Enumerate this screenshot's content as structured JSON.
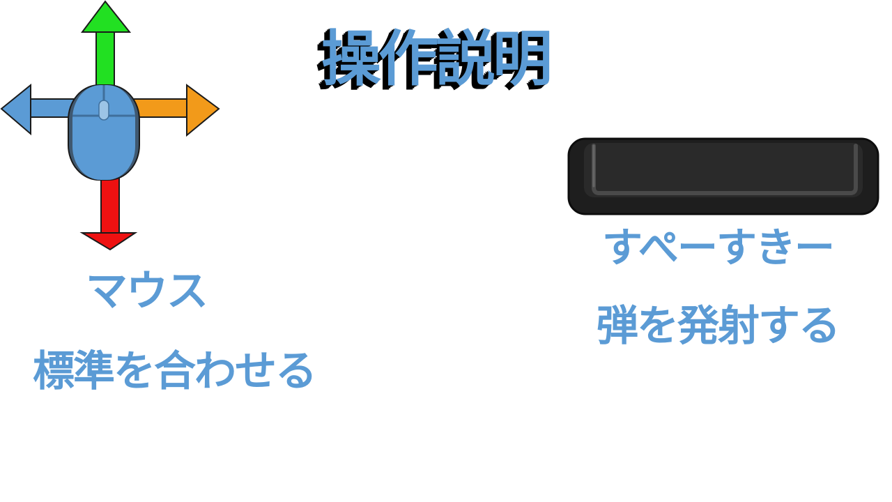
{
  "title": "操作説明",
  "mouse": {
    "name": "マウス",
    "description": "標準を合わせる",
    "icon": "mouse-with-direction-arrows-icon",
    "arrow_colors": {
      "up": "#22e022",
      "down": "#ee1111",
      "left": "#5b9bd5",
      "right": "#f29a1a"
    }
  },
  "spacebar": {
    "name": "すぺーすきー",
    "description": "弾を発射する",
    "icon": "spacebar-key-icon"
  },
  "colors": {
    "text": "#5b9bd5",
    "title_shadow": "#000000",
    "background": "#ffffff"
  }
}
